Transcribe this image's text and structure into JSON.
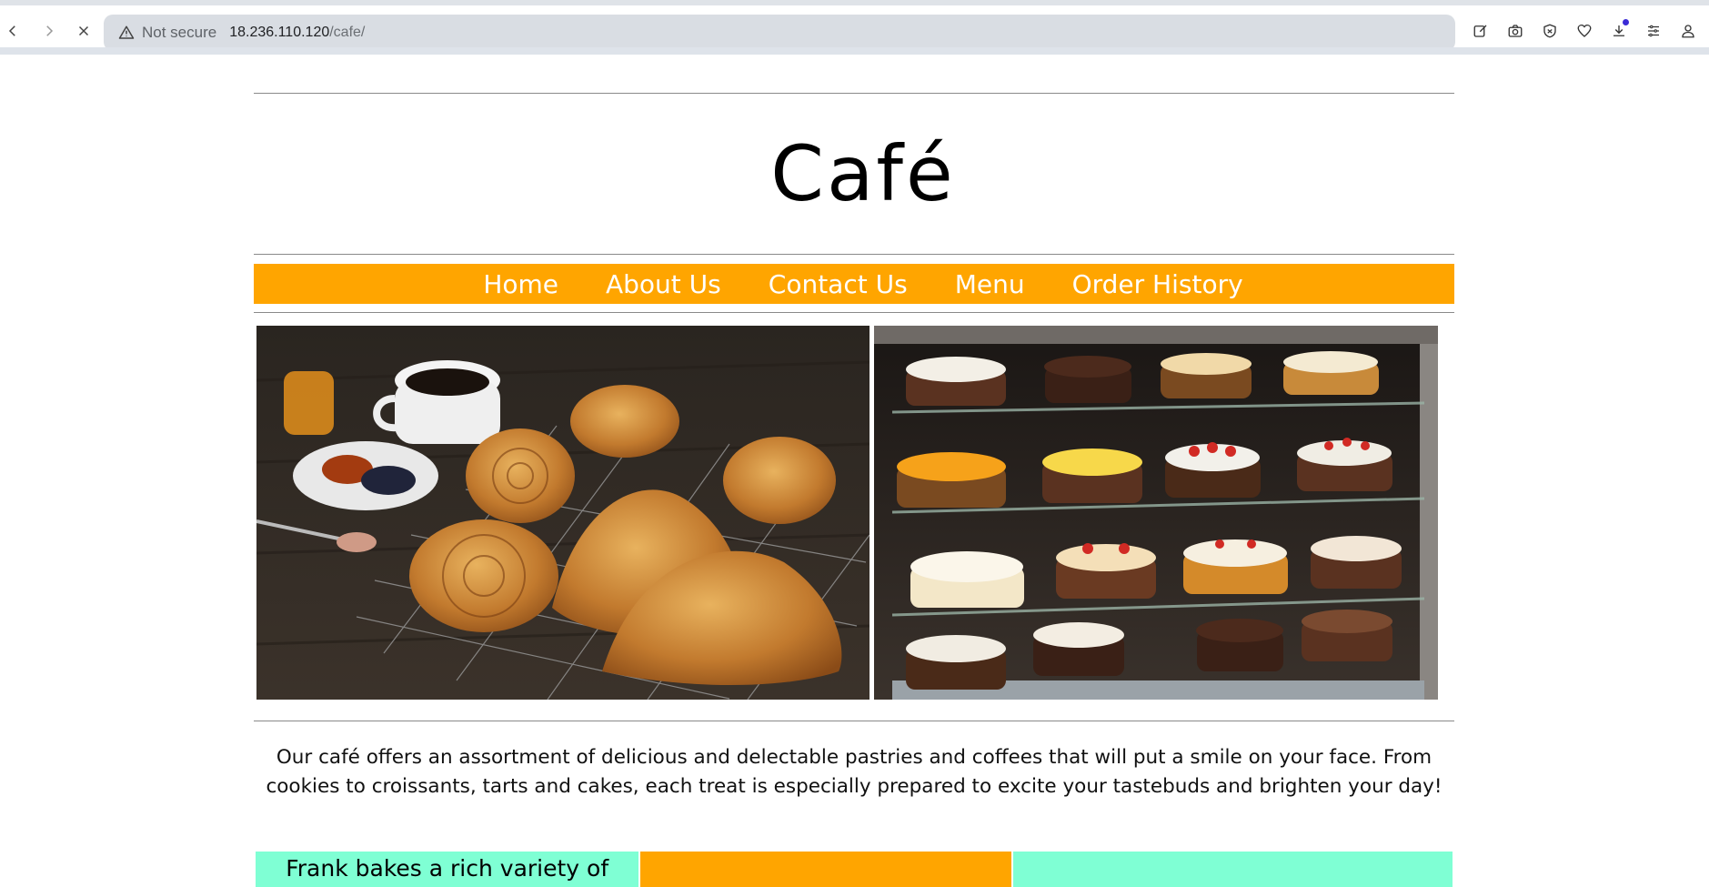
{
  "browser": {
    "security_label": "Not secure",
    "url_host": "18.236.110.120",
    "url_path": "/cafe/",
    "icons": [
      "back-icon",
      "forward-icon",
      "stop-loading-icon",
      "warning-icon",
      "edit-icon",
      "camera-icon",
      "shield-icon",
      "heart-icon",
      "download-icon",
      "menu-icon",
      "profile-icon"
    ]
  },
  "site": {
    "title": "Café",
    "nav": [
      "Home",
      "About Us",
      "Contact Us",
      "Menu",
      "Order History"
    ],
    "intro": "Our café offers an assortment of delicious and delectable pastries and coffees that will put a smile on your face. From cookies to croissants, tarts and cakes, each treat is especially prepared to excite your tastebuds and brighten your day!",
    "section_text": "Frank bakes a rich variety of"
  },
  "colors": {
    "nav_bg": "#ffa500",
    "accent_aqua": "#7fffd4"
  }
}
